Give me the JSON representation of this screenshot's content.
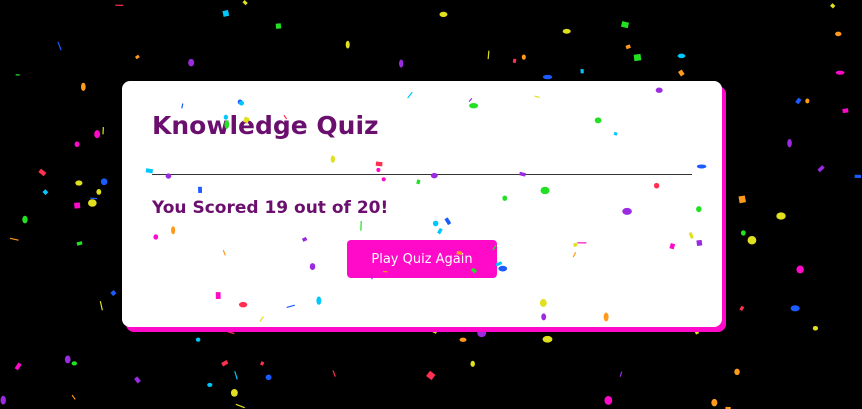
{
  "quiz": {
    "title": "Knowledge Quiz",
    "score_text": "You Scored 19 out of 20!",
    "play_again_label": "Play Quiz Again"
  },
  "theme": {
    "background": "#000000",
    "card": "#ffffff",
    "accent": "#ff0ac8",
    "text": "#6b0f6e"
  },
  "confetti_colors": [
    "#ff0ac8",
    "#00c8ff",
    "#22e022",
    "#e0e020",
    "#9a2be0",
    "#ff3050",
    "#ff9a1a",
    "#1a5cff"
  ]
}
